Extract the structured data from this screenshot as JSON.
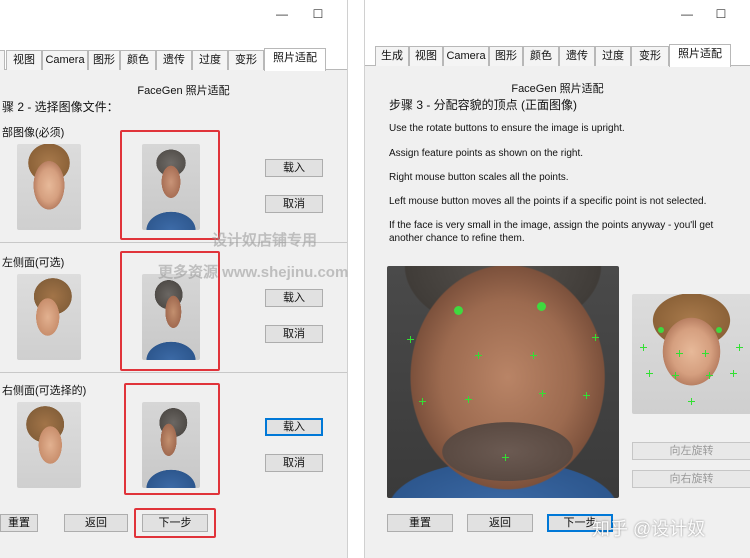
{
  "left": {
    "window_controls": {
      "minimize": "—",
      "maximize": "☐"
    },
    "tabs": [
      "视图",
      "Camera",
      "图形",
      "颜色",
      "遗传",
      "过度",
      "变形",
      "照片适配"
    ],
    "header": "FaceGen 照片适配",
    "step": "骤 2 - 选择图像文件：",
    "sections": [
      {
        "label": "部图像(必须)",
        "load": "载入",
        "cancel": "取消"
      },
      {
        "label": "左侧面(可选)",
        "load": "载入",
        "cancel": "取消"
      },
      {
        "label": "右侧面(可选择的)",
        "load": "载入",
        "cancel": "取消"
      }
    ],
    "bottom": {
      "reset": "重置",
      "back": "返回",
      "next": "下一步"
    }
  },
  "right": {
    "window_controls": {
      "minimize": "—",
      "maximize": "☐"
    },
    "tabs": [
      "生成",
      "视图",
      "Camera",
      "图形",
      "颜色",
      "遗传",
      "过度",
      "变形",
      "照片适配"
    ],
    "header": "FaceGen 照片适配",
    "step": "步骤 3 - 分配容貌的顶点 (正面图像)",
    "instructions": [
      "Use the rotate buttons to ensure the image is upright.",
      "Assign feature points as shown on the right.",
      "Right mouse button scales all the points.",
      "Left mouse button moves all the points if a specific point is not selected.",
      "If the face is very small in the image, assign the points anyway - you'll get another chance to refine them."
    ],
    "rotate_left": "向左旋转",
    "rotate_right": "向右旋转",
    "bottom": {
      "reset": "重置",
      "back": "返回",
      "next": "下一步"
    }
  },
  "watermarks": {
    "shop": "设计奴店铺专用",
    "site": "更多资源 www.shejinu.com",
    "zhihu": "知乎 @设计奴"
  },
  "colors": {
    "highlight_box": "#e0333a",
    "feature_point": "#33e033",
    "focus": "#0078d7"
  }
}
